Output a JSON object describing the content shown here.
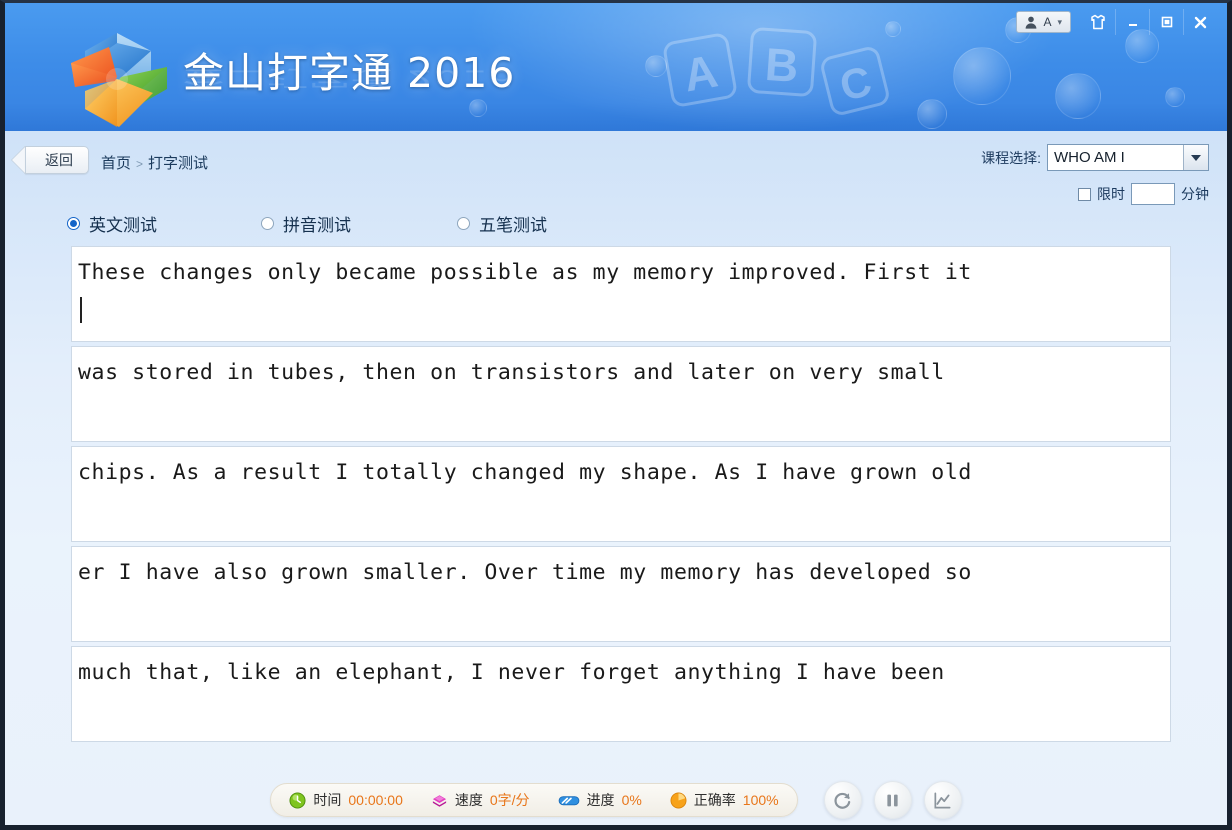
{
  "window": {
    "title": "金山打字通 2016",
    "user_chip": {
      "user_icon": "user-icon",
      "letter": "A",
      "caret": "▾"
    },
    "buttons": {
      "shirt": "shirt-icon",
      "minimize": "–",
      "maximize": "❐",
      "close": "✕"
    }
  },
  "header": {
    "logo": "kingsoft-pinwheel-logo",
    "watermark_blocks": [
      "A",
      "B",
      "C"
    ]
  },
  "nav": {
    "back_label": "返回",
    "breadcrumb": {
      "home": "首页",
      "separator": ">",
      "current": "打字测试"
    }
  },
  "course": {
    "label": "课程选择:",
    "selected": "WHO AM I",
    "options": [
      "WHO AM I"
    ]
  },
  "limit": {
    "checkbox_checked": false,
    "label": "限时",
    "value": "",
    "unit": "分钟"
  },
  "modes": [
    {
      "label": "英文测试",
      "checked": true
    },
    {
      "label": "拼音测试",
      "checked": false
    },
    {
      "label": "五笔测试",
      "checked": false
    }
  ],
  "typing": {
    "lines": [
      "These changes only became possible as my memory improved. First it",
      "was stored in tubes, then on transistors and later on very small",
      "chips. As a result I totally changed my shape. As I have grown old",
      "er I have also grown smaller. Over time my memory has developed so",
      "much that, like an elephant, I never forget anything I have been"
    ],
    "caret_on_line": 0
  },
  "status": {
    "time": {
      "icon": "clock-icon",
      "label": "时间",
      "value": "00:00:00"
    },
    "speed": {
      "icon": "speed-icon",
      "label": "速度",
      "value": "0字/分"
    },
    "progress": {
      "icon": "progress-icon",
      "label": "进度",
      "value": "0%"
    },
    "accuracy": {
      "icon": "accuracy-pie-icon",
      "label": "正确率",
      "value": "100%"
    },
    "actions": [
      {
        "name": "restart-button",
        "icon": "restart-icon"
      },
      {
        "name": "pause-button",
        "icon": "pause-icon"
      },
      {
        "name": "statistics-button",
        "icon": "chart-icon"
      }
    ]
  },
  "colors": {
    "header_blue": "#3d8ce8",
    "accent_orange": "#e8761a",
    "radio_blue": "#1464c8",
    "body_bg": "#eaf3fc"
  }
}
